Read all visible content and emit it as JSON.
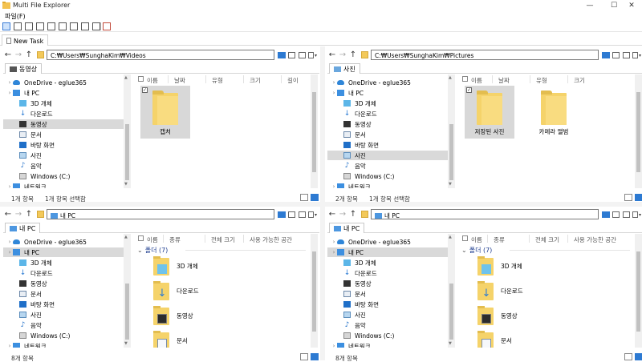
{
  "window": {
    "title": "Multi File Explorer",
    "minimize": "—",
    "maximize": "☐",
    "close": "✕"
  },
  "menu": {
    "file": "파일(F)"
  },
  "task_tab": {
    "label": "New Task"
  },
  "panes": [
    {
      "address": "C:₩Users₩SunghaKim₩Videos",
      "tab": "동영상",
      "view": "icons",
      "columns": [
        "이름",
        "날짜",
        "유형",
        "크기",
        "길이"
      ],
      "tiles": [
        {
          "label": "캡처",
          "selected": true
        }
      ],
      "status_count": "1개 항목",
      "status_selected": "1개 항목 선택함",
      "selected_nav": "동영상"
    },
    {
      "address": "C:₩Users₩SunghaKim₩Pictures",
      "tab": "사진",
      "view": "icons",
      "columns": [
        "이름",
        "날짜",
        "유형",
        "크기"
      ],
      "tiles": [
        {
          "label": "저장된 사진",
          "selected": true
        },
        {
          "label": "카메라 앨범",
          "selected": false
        }
      ],
      "status_count": "2개 항목",
      "status_selected": "1개 항목 선택함",
      "selected_nav": "사진"
    },
    {
      "address": "내 PC",
      "tab": "내 PC",
      "view": "list",
      "columns": [
        "이름",
        "종류",
        "전체 크기",
        "사용 가능한 공간"
      ],
      "group": "폴더 (7)",
      "rows": [
        {
          "name": "3D 개체",
          "icon": "cube"
        },
        {
          "name": "다운로드",
          "icon": "download"
        },
        {
          "name": "동영상",
          "icon": "video"
        },
        {
          "name": "문서",
          "icon": "document"
        }
      ],
      "status_count": "8개 항목",
      "status_selected": "",
      "selected_nav": "내 PC"
    },
    {
      "address": "내 PC",
      "tab": "내 PC",
      "view": "list",
      "columns": [
        "이름",
        "종류",
        "전체 크기",
        "사용 가능한 공간"
      ],
      "group": "폴더 (7)",
      "rows": [
        {
          "name": "3D 개체",
          "icon": "cube"
        },
        {
          "name": "다운로드",
          "icon": "download"
        },
        {
          "name": "동영상",
          "icon": "video"
        },
        {
          "name": "문서",
          "icon": "document"
        }
      ],
      "status_count": "8개 항목",
      "status_selected": "",
      "selected_nav": "내 PC"
    }
  ],
  "nav_tree": [
    {
      "label": "OneDrive - eglue365",
      "icon": "onedrive-icon"
    },
    {
      "label": "내 PC",
      "icon": "pc-icon"
    },
    {
      "label": "3D 개체",
      "icon": "cube-icon"
    },
    {
      "label": "다운로드",
      "icon": "download-icon"
    },
    {
      "label": "동영상",
      "icon": "video-icon"
    },
    {
      "label": "문서",
      "icon": "document-icon"
    },
    {
      "label": "바탕 화면",
      "icon": "desktop-icon"
    },
    {
      "label": "사진",
      "icon": "pictures-icon"
    },
    {
      "label": "음악",
      "icon": "music-icon"
    },
    {
      "label": "Windows  (C:)",
      "icon": "drive-icon"
    },
    {
      "label": "네트워크",
      "icon": "network-icon"
    }
  ]
}
